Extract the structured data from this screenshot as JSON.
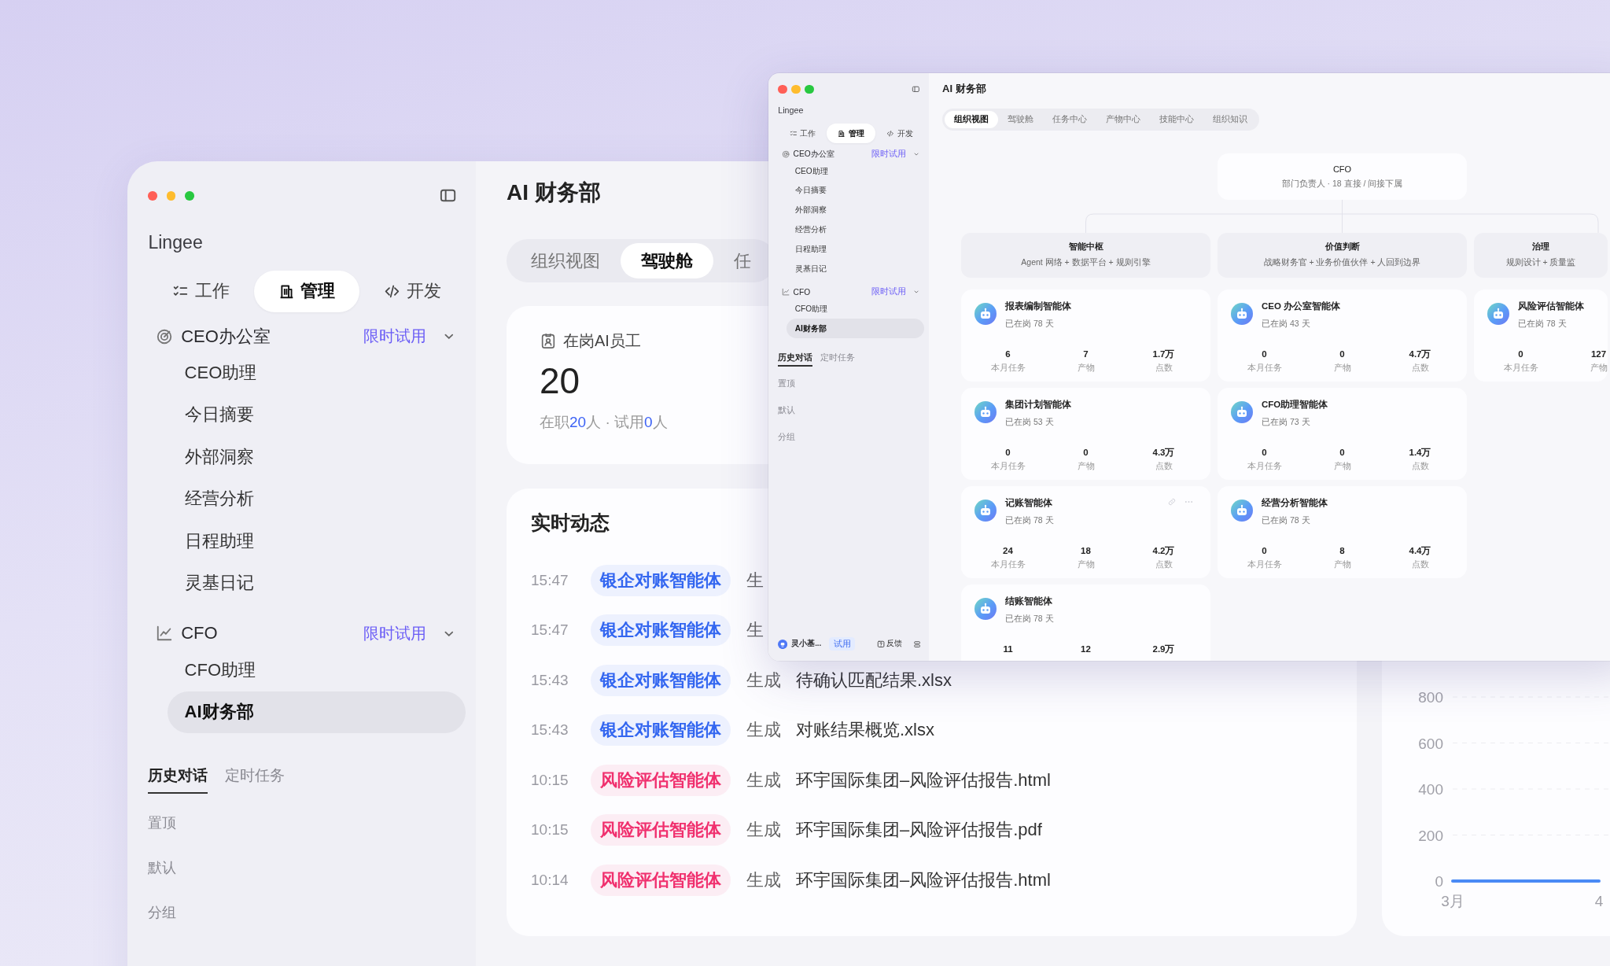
{
  "main_window": {
    "sidebar": {
      "brand": "Lingee",
      "nav_tabs": [
        {
          "label": "工作",
          "selected": false
        },
        {
          "label": "管理",
          "selected": true
        },
        {
          "label": "开发",
          "selected": false
        }
      ],
      "sections": [
        {
          "title": "CEO办公室",
          "badge": "限时试用",
          "expanded": true,
          "items": [
            {
              "label": "CEO助理",
              "selected": false
            },
            {
              "label": "今日摘要",
              "selected": false
            },
            {
              "label": "外部洞察",
              "selected": false
            },
            {
              "label": "经营分析",
              "selected": false
            },
            {
              "label": "日程助理",
              "selected": false
            },
            {
              "label": "灵基日记",
              "selected": false
            }
          ]
        },
        {
          "title": "CFO",
          "badge": "限时试用",
          "expanded": true,
          "items": [
            {
              "label": "CFO助理",
              "selected": false
            },
            {
              "label": "AI财务部",
              "selected": true
            }
          ]
        }
      ],
      "history_tabs": [
        {
          "label": "历史对话",
          "selected": true
        },
        {
          "label": "定时任务",
          "selected": false
        }
      ],
      "history_groups": [
        "置顶",
        "默认",
        "分组"
      ]
    },
    "page": {
      "title": "AI 财务部",
      "tabs": [
        {
          "label": "组织视图",
          "selected": false
        },
        {
          "label": "驾驶舱",
          "selected": true
        },
        {
          "label": "任",
          "selected": false
        }
      ],
      "staff_card": {
        "label": "在岗AI员工",
        "value": "20",
        "detail": [
          {
            "text": "在职",
            "highlight": false
          },
          {
            "text": "20",
            "highlight": true
          },
          {
            "text": "人 · 试用",
            "highlight": false
          },
          {
            "text": "0",
            "highlight": true
          },
          {
            "text": "人",
            "highlight": false
          }
        ]
      },
      "activity": {
        "title": "实时动态",
        "rows": [
          {
            "time": "15:47",
            "agent": "银企对账智能体",
            "color": "#3366f0",
            "verb": "生"
          },
          {
            "time": "15:47",
            "agent": "银企对账智能体",
            "color": "#3366f0",
            "verb": "生"
          },
          {
            "time": "15:43",
            "agent": "银企对账智能体",
            "color": "#3366f0",
            "verb": "生成",
            "file": "待确认匹配结果.xlsx"
          },
          {
            "time": "15:43",
            "agent": "银企对账智能体",
            "color": "#3366f0",
            "verb": "生成",
            "file": "对账结果概览.xlsx"
          },
          {
            "time": "10:15",
            "agent": "风险评估智能体",
            "color": "#f0306e",
            "verb": "生成",
            "file": "环宇国际集团–风险评估报告.html"
          },
          {
            "time": "10:15",
            "agent": "风险评估智能体",
            "color": "#f0306e",
            "verb": "生成",
            "file": "环宇国际集团–风险评估报告.pdf"
          },
          {
            "time": "10:14",
            "agent": "风险评估智能体",
            "color": "#f0306e",
            "verb": "生成",
            "file": "环宇国际集团–风险评估报告.html"
          }
        ]
      },
      "trend_chart": {
        "chart_data": {
          "type": "line",
          "categories": [
            "3月",
            "4"
          ],
          "series": [
            {
              "color": "#4a8af5",
              "values": [
                0,
                0
              ]
            }
          ],
          "ylim": [
            0,
            800
          ],
          "yticks": [
            0,
            200,
            400,
            600,
            800
          ],
          "grid": true
        }
      }
    }
  },
  "front_window": {
    "sidebar": {
      "brand": "Lingee",
      "nav_tabs": [
        {
          "label": "工作",
          "selected": false
        },
        {
          "label": "管理",
          "selected": true
        },
        {
          "label": "开发",
          "selected": false
        }
      ],
      "sections": [
        {
          "title": "CEO办公室",
          "badge": "限时试用",
          "expanded": true,
          "items": [
            {
              "label": "CEO助理",
              "selected": false
            },
            {
              "label": "今日摘要",
              "selected": false
            },
            {
              "label": "外部洞察",
              "selected": false
            },
            {
              "label": "经营分析",
              "selected": false
            },
            {
              "label": "日程助理",
              "selected": false
            },
            {
              "label": "灵基日记",
              "selected": false
            }
          ]
        },
        {
          "title": "CFO",
          "badge": "限时试用",
          "expanded": true,
          "items": [
            {
              "label": "CFO助理",
              "selected": false
            },
            {
              "label": "AI财务部",
              "selected": true
            }
          ]
        }
      ],
      "history_tabs": [
        {
          "label": "历史对话",
          "selected": true
        },
        {
          "label": "定时任务",
          "selected": false
        }
      ],
      "history_groups": [
        "置顶",
        "默认",
        "分组"
      ],
      "footer": {
        "user": "灵小基...",
        "badge": "试用",
        "feedback": "反馈"
      }
    },
    "page": {
      "title": "AI 财务部",
      "tabs": [
        {
          "label": "组织视图",
          "selected": true
        },
        {
          "label": "驾驶舱",
          "selected": false
        },
        {
          "label": "任务中心",
          "selected": false
        },
        {
          "label": "产物中心",
          "selected": false
        },
        {
          "label": "技能中心",
          "selected": false
        },
        {
          "label": "组织知识",
          "selected": false
        }
      ],
      "org_chart": {
        "root": {
          "title": "CFO",
          "subtitle": "部门负责人 · 18 直接 / 间接下属"
        },
        "groups": [
          {
            "title": "智能中枢",
            "subtitle": "Agent 网络 + 数据平台 + 规则引擎",
            "agents": [
              {
                "name": "报表编制智能体",
                "tenure": "已在岗 78 天",
                "actions_visible": false,
                "stats": [
                  {
                    "value": "6",
                    "label": "本月任务"
                  },
                  {
                    "value": "7",
                    "label": "产物"
                  },
                  {
                    "value": "1.7万",
                    "label": "点数"
                  }
                ]
              },
              {
                "name": "集团计划智能体",
                "tenure": "已在岗 53 天",
                "actions_visible": false,
                "stats": [
                  {
                    "value": "0",
                    "label": "本月任务"
                  },
                  {
                    "value": "0",
                    "label": "产物"
                  },
                  {
                    "value": "4.3万",
                    "label": "点数"
                  }
                ]
              },
              {
                "name": "记账智能体",
                "tenure": "已在岗 78 天",
                "actions_visible": true,
                "stats": [
                  {
                    "value": "24",
                    "label": "本月任务"
                  },
                  {
                    "value": "18",
                    "label": "产物"
                  },
                  {
                    "value": "4.2万",
                    "label": "点数"
                  }
                ]
              },
              {
                "name": "结账智能体",
                "tenure": "已在岗 78 天",
                "actions_visible": false,
                "stats": [
                  {
                    "value": "11"
                  },
                  {
                    "value": "12"
                  },
                  {
                    "value": "2.9万"
                  }
                ]
              }
            ]
          },
          {
            "title": "价值判断",
            "subtitle": "战略财务官 + 业务价值伙伴 + 人回到边界",
            "agents": [
              {
                "name": "CEO 办公室智能体",
                "tenure": "已在岗 43 天",
                "actions_visible": false,
                "stats": [
                  {
                    "value": "0",
                    "label": "本月任务"
                  },
                  {
                    "value": "0",
                    "label": "产物"
                  },
                  {
                    "value": "4.7万",
                    "label": "点数"
                  }
                ]
              },
              {
                "name": "CFO助理智能体",
                "tenure": "已在岗 73 天",
                "actions_visible": false,
                "stats": [
                  {
                    "value": "0",
                    "label": "本月任务"
                  },
                  {
                    "value": "0",
                    "label": "产物"
                  },
                  {
                    "value": "1.4万",
                    "label": "点数"
                  }
                ]
              },
              {
                "name": "经营分析智能体",
                "tenure": "已在岗 78 天",
                "actions_visible": false,
                "stats": [
                  {
                    "value": "0",
                    "label": "本月任务"
                  },
                  {
                    "value": "8",
                    "label": "产物"
                  },
                  {
                    "value": "4.4万",
                    "label": "点数"
                  }
                ]
              }
            ]
          },
          {
            "title": "治理",
            "subtitle": "规则设计 + 质量监",
            "agents": [
              {
                "name": "风险评估智能体",
                "tenure": "已在岗 78 天",
                "actions_visible": false,
                "stats": [
                  {
                    "value": "0",
                    "label": "本月任务"
                  },
                  {
                    "value": "127",
                    "label": "产物"
                  }
                ]
              }
            ]
          }
        ]
      }
    }
  }
}
